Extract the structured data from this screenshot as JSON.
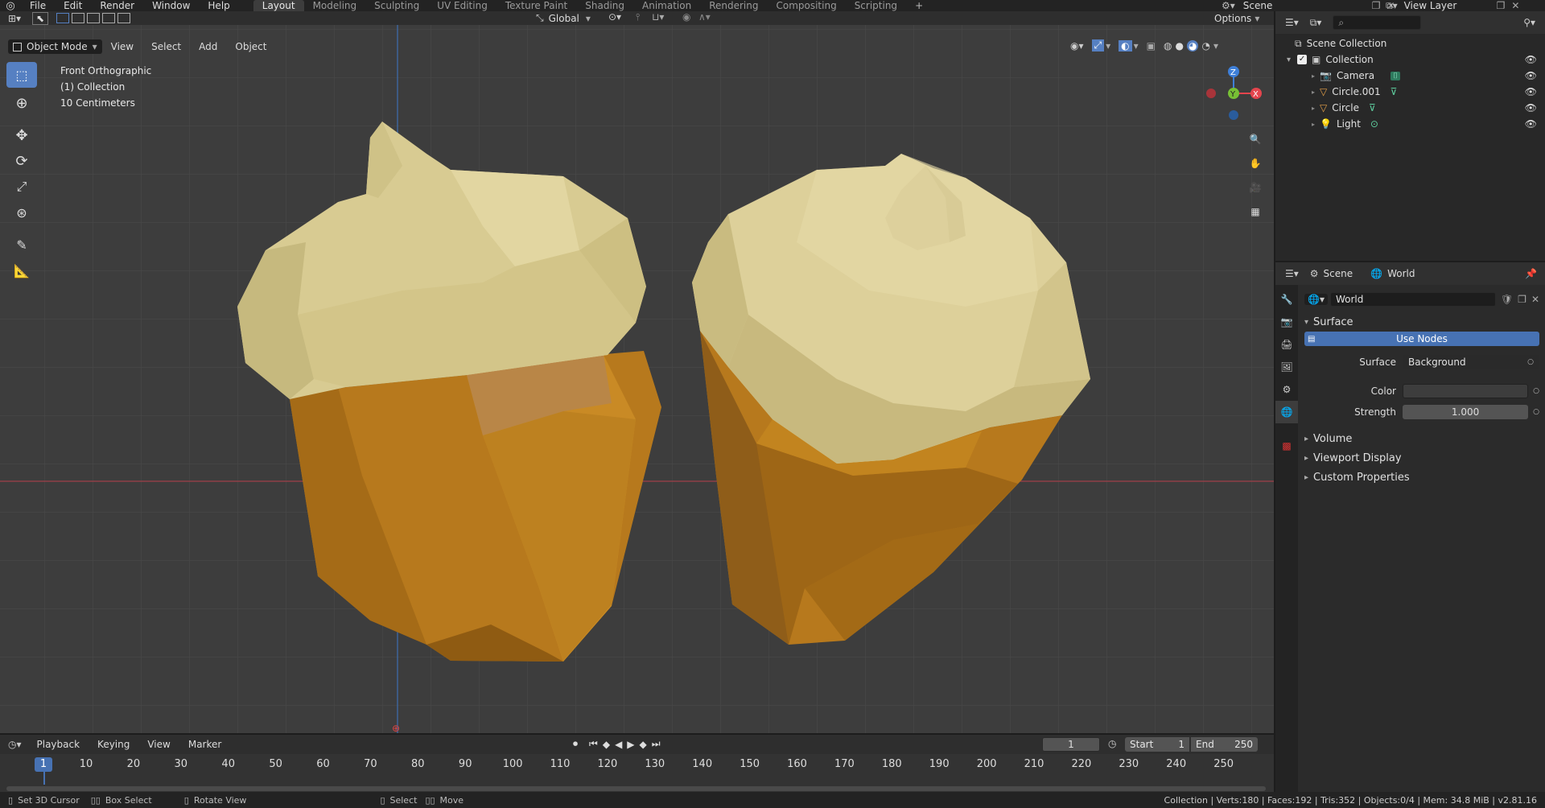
{
  "topbar": {
    "menus": [
      "File",
      "Edit",
      "Render",
      "Window",
      "Help"
    ],
    "workspaces": [
      "Layout",
      "Modeling",
      "Sculpting",
      "UV Editing",
      "Texture Paint",
      "Shading",
      "Animation",
      "Rendering",
      "Compositing",
      "Scripting"
    ],
    "active_workspace": "Layout",
    "scene_name": "Scene",
    "view_layer": "View Layer"
  },
  "tool_header": {
    "orientation": "Global",
    "options": "Options"
  },
  "viewport_header": {
    "mode": "Object Mode",
    "menus": [
      "View",
      "Select",
      "Add",
      "Object"
    ]
  },
  "viewport": {
    "view_name": "Front Orthographic",
    "collection": "(1) Collection",
    "scale": "10 Centimeters",
    "gizmo": {
      "z": "Z",
      "y": "Y",
      "x": "X"
    }
  },
  "outliner": {
    "root": "Scene Collection",
    "collection": "Collection",
    "items": [
      {
        "label": "Camera",
        "icon": "camera-icon"
      },
      {
        "label": "Circle.001",
        "icon": "mesh-icon"
      },
      {
        "label": "Circle",
        "icon": "mesh-icon"
      },
      {
        "label": "Light",
        "icon": "light-icon"
      }
    ]
  },
  "properties": {
    "tabs": [
      "Scene",
      "World"
    ],
    "world_name": "World",
    "surface_panel": "Surface",
    "use_nodes": "Use Nodes",
    "surface_label": "Surface",
    "surface_value": "Background",
    "color_label": "Color",
    "color_value": "#3d3d3d",
    "strength_label": "Strength",
    "strength_value": "1.000",
    "collapsed_panels": [
      "Volume",
      "Viewport Display",
      "Custom Properties"
    ]
  },
  "timeline": {
    "menus": [
      "Playback",
      "Keying",
      "View",
      "Marker"
    ],
    "current_frame": "1",
    "start_label": "Start",
    "start_value": "1",
    "end_label": "End",
    "end_value": "250",
    "ticks": [
      "10",
      "20",
      "30",
      "40",
      "50",
      "60",
      "70",
      "80",
      "90",
      "100",
      "110",
      "120",
      "130",
      "140",
      "150",
      "160",
      "170",
      "180",
      "190",
      "200",
      "210",
      "220",
      "230",
      "240",
      "250"
    ],
    "playhead": "1"
  },
  "statusbar": {
    "hints": [
      "Set 3D Cursor",
      "Box Select",
      "Rotate View",
      "Select",
      "Move"
    ],
    "stats": "Collection | Verts:180 | Faces:192 | Tris:352 | Objects:0/4 | Mem: 34.8 MiB | v2.81.16"
  },
  "colors": {
    "accent": "#5680c2",
    "axis_x": "#e4454d",
    "axis_y": "#77c035",
    "axis_z": "#3e7fd8",
    "cap": "#d9cc93",
    "body": "#c8871f"
  }
}
